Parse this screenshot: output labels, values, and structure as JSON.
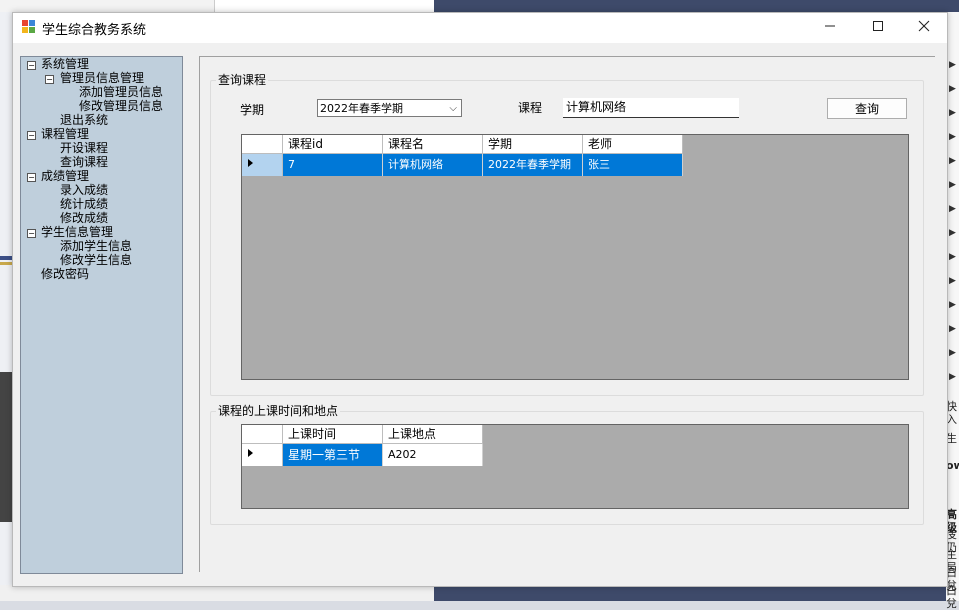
{
  "window": {
    "title": "学生综合教务系统"
  },
  "tree": {
    "nodes": [
      {
        "label": "系统管理"
      },
      {
        "label": "管理员信息管理"
      },
      {
        "label": "添加管理员信息"
      },
      {
        "label": "修改管理员信息"
      },
      {
        "label": "退出系统"
      },
      {
        "label": "课程管理"
      },
      {
        "label": "开设课程"
      },
      {
        "label": "查询课程"
      },
      {
        "label": "成绩管理"
      },
      {
        "label": "录入成绩"
      },
      {
        "label": "统计成绩"
      },
      {
        "label": "修改成绩"
      },
      {
        "label": "学生信息管理"
      },
      {
        "label": "添加学生信息"
      },
      {
        "label": "修改学生信息"
      },
      {
        "label": "修改密码"
      }
    ],
    "expand_glyph": "−"
  },
  "query": {
    "group_title": "查询课程",
    "semester_label": "学期",
    "semester_value": "2022年春季学期",
    "course_label": "课程",
    "course_value": "计算机网络",
    "search_button": "查询"
  },
  "course_grid": {
    "columns": [
      "课程id",
      "课程名",
      "学期",
      "老师"
    ],
    "rows": [
      [
        "7",
        "计算机网络",
        "2022年春季学期",
        "张三"
      ]
    ]
  },
  "schedule": {
    "group_title": "课程的上课时间和地点",
    "columns": [
      "上课时间",
      "上课地点"
    ],
    "rows": [
      [
        "星期一第三节",
        "A202"
      ]
    ]
  },
  "background": {
    "right_text": [
      "快入",
      "生",
      "ow",
      "高级",
      "庋仍",
      "主局",
      "白兌",
      "白兌"
    ]
  },
  "colors": {
    "selection": "#0078d7",
    "tree_bg": "#bfcfdc",
    "grid_bg": "#ababab"
  }
}
